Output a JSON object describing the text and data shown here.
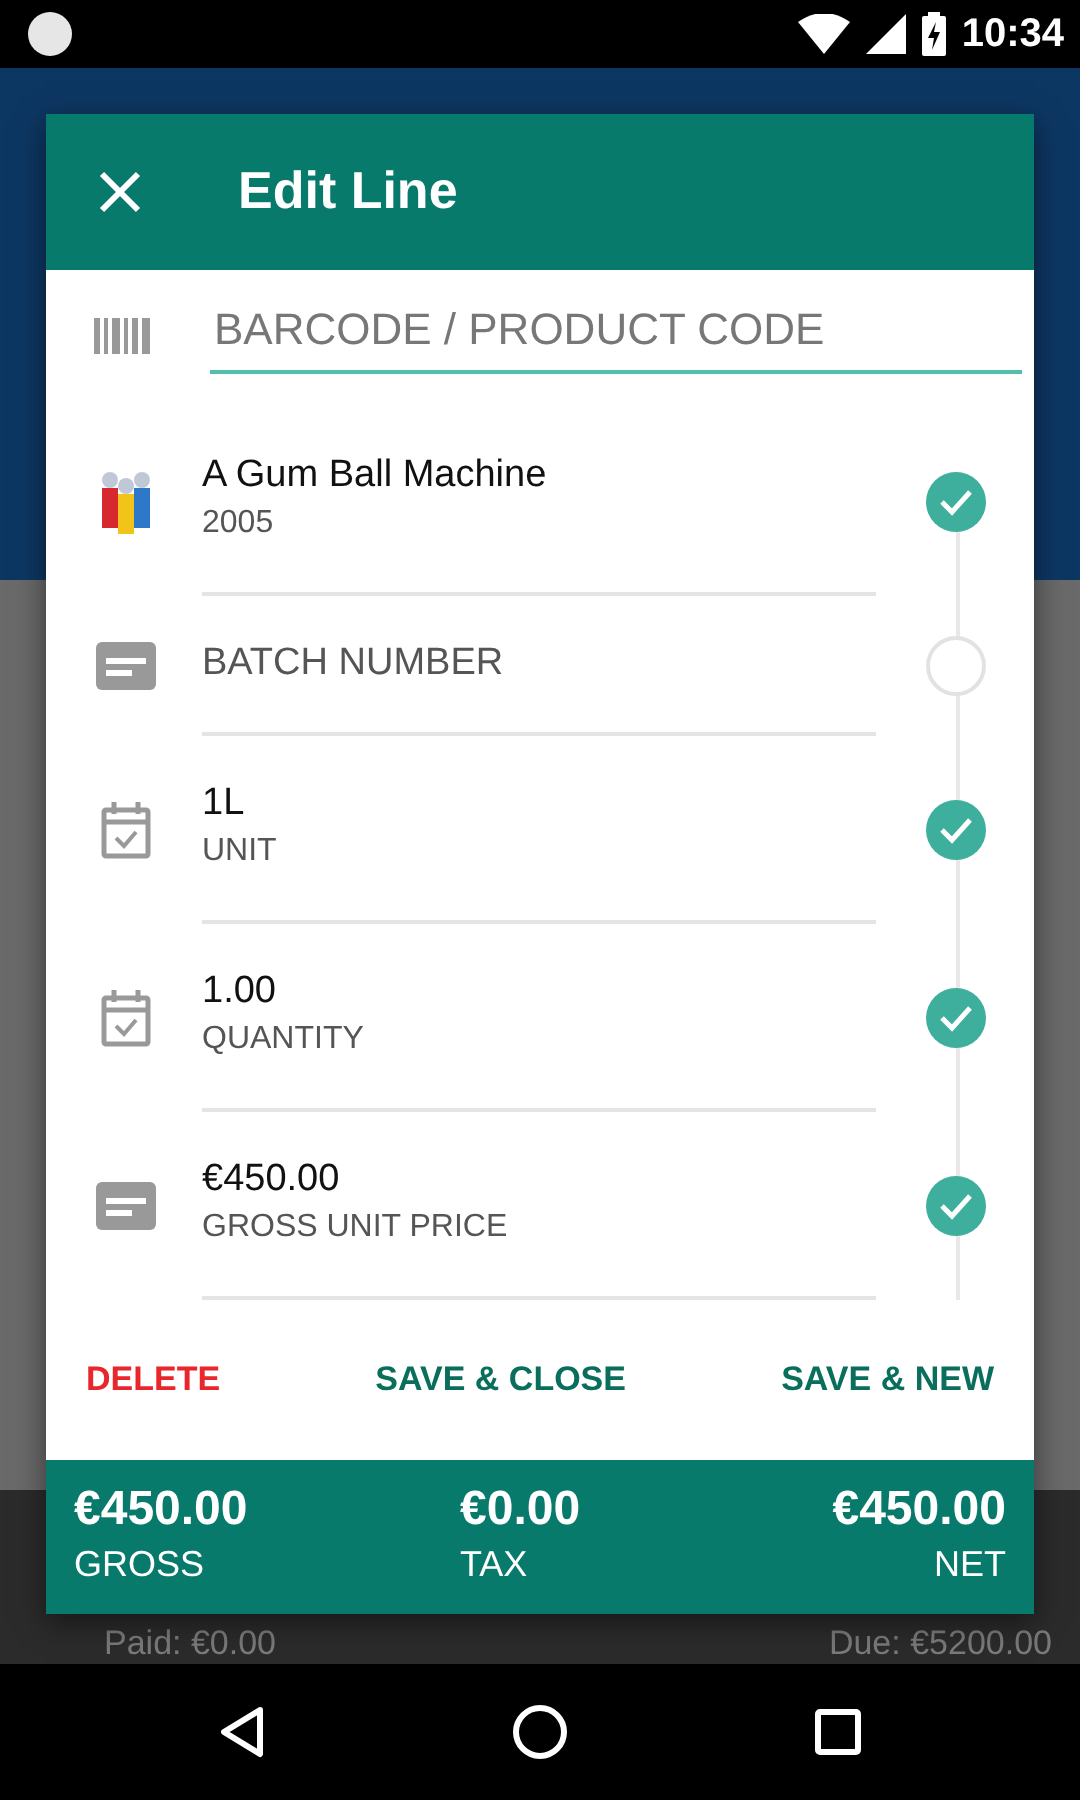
{
  "status_bar": {
    "time": "10:34"
  },
  "background": {
    "paid": "Paid: €0.00",
    "due": "Due: €5200.00"
  },
  "dialog": {
    "title": "Edit Line",
    "barcode_field": {
      "placeholder": "BARCODE / PRODUCT CODE"
    },
    "fields": [
      {
        "kind": "product",
        "value": "A Gum Ball Machine",
        "label": "2005",
        "done": true
      },
      {
        "kind": "card",
        "placeholder": "BATCH NUMBER",
        "done": false
      },
      {
        "kind": "calendar",
        "value": "1L",
        "label": "UNIT",
        "done": true
      },
      {
        "kind": "calendar",
        "value": "1.00",
        "label": "QUANTITY",
        "done": true
      },
      {
        "kind": "card",
        "value": "€450.00",
        "label": "GROSS UNIT PRICE",
        "done": true
      }
    ],
    "actions": [
      {
        "label": "DELETE",
        "kind": "danger"
      },
      {
        "label": "SAVE & CLOSE",
        "kind": "primary"
      },
      {
        "label": "SAVE & NEW",
        "kind": "primary"
      }
    ],
    "totals": [
      {
        "amount": "€450.00",
        "label": "GROSS"
      },
      {
        "amount": "€0.00",
        "label": "TAX"
      },
      {
        "amount": "€450.00",
        "label": "NET"
      }
    ]
  }
}
